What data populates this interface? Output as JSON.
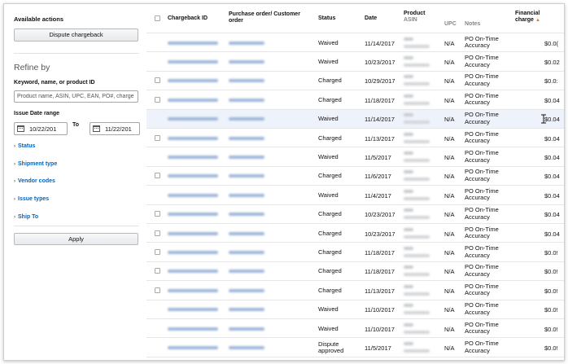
{
  "sidebar": {
    "available_actions": "Available actions",
    "dispute_button": "Dispute chargeback",
    "refine_by": "Refine by",
    "keyword_label": "Keyword, name, or product ID",
    "keyword_placeholder": "Product name, ASIN, UPC, EAN, PO#, charge",
    "issue_date_label": "Issue Date range",
    "date_from": "10/22/201",
    "to_label": "To",
    "date_to": "11/22/201",
    "filters": [
      "Status",
      "Shipment type",
      "Vendor codes",
      "Issue types",
      "Ship To"
    ],
    "apply_button": "Apply"
  },
  "table": {
    "headers": {
      "chargeback_id": "Chargeback ID",
      "purchase_order": "Purchase order/ Customer order",
      "status": "Status",
      "date": "Date",
      "product": "Product",
      "asin": "ASIN",
      "upc": "UPC",
      "notes": "Notes",
      "financial_charge": "Financial charge",
      "sort_indicator": "▲"
    },
    "rows": [
      {
        "status": "Waived",
        "date": "11/14/2017",
        "upc": "N/A",
        "notes": "PO On-Time Accuracy",
        "charge": "$0.0(",
        "checkbox": false
      },
      {
        "status": "Waived",
        "date": "10/23/2017",
        "upc": "N/A",
        "notes": "PO On-Time Accuracy",
        "charge": "$0.02",
        "checkbox": false
      },
      {
        "status": "Charged",
        "date": "10/29/2017",
        "upc": "N/A",
        "notes": "PO On-Time Accuracy",
        "charge": "$0.0:",
        "checkbox": true
      },
      {
        "status": "Charged",
        "date": "11/18/2017",
        "upc": "N/A",
        "notes": "PO On-Time Accuracy",
        "charge": "$0.04",
        "checkbox": true
      },
      {
        "status": "Waived",
        "date": "11/14/2017",
        "upc": "N/A",
        "notes": "PO On-Time Accuracy",
        "charge": "$0.04",
        "checkbox": false,
        "highlight": true
      },
      {
        "status": "Charged",
        "date": "11/13/2017",
        "upc": "N/A",
        "notes": "PO On-Time Accuracy",
        "charge": "$0.04",
        "checkbox": true
      },
      {
        "status": "Waived",
        "date": "11/5/2017",
        "upc": "N/A",
        "notes": "PO On-Time Accuracy",
        "charge": "$0.04",
        "checkbox": false
      },
      {
        "status": "Charged",
        "date": "11/6/2017",
        "upc": "N/A",
        "notes": "PO On-Time Accuracy",
        "charge": "$0.04",
        "checkbox": true
      },
      {
        "status": "Waived",
        "date": "11/4/2017",
        "upc": "N/A",
        "notes": "PO On-Time Accuracy",
        "charge": "$0.04",
        "checkbox": false
      },
      {
        "status": "Charged",
        "date": "10/23/2017",
        "upc": "N/A",
        "notes": "PO On-Time Accuracy",
        "charge": "$0.04",
        "checkbox": true
      },
      {
        "status": "Charged",
        "date": "10/23/2017",
        "upc": "N/A",
        "notes": "PO On-Time Accuracy",
        "charge": "$0.04",
        "checkbox": true
      },
      {
        "status": "Charged",
        "date": "11/18/2017",
        "upc": "N/A",
        "notes": "PO On-Time Accuracy",
        "charge": "$0.0!",
        "checkbox": true
      },
      {
        "status": "Charged",
        "date": "11/18/2017",
        "upc": "N/A",
        "notes": "PO On-Time Accuracy",
        "charge": "$0.0!",
        "checkbox": true
      },
      {
        "status": "Charged",
        "date": "11/13/2017",
        "upc": "N/A",
        "notes": "PO On-Time Accuracy",
        "charge": "$0.0!",
        "checkbox": true
      },
      {
        "status": "Waived",
        "date": "11/10/2017",
        "upc": "N/A",
        "notes": "PO On-Time Accuracy",
        "charge": "$0.0!",
        "checkbox": false
      },
      {
        "status": "Waived",
        "date": "11/10/2017",
        "upc": "N/A",
        "notes": "PO On-Time Accuracy",
        "charge": "$0.0!",
        "checkbox": false
      },
      {
        "status": "Dispute approved",
        "date": "11/5/2017",
        "upc": "N/A",
        "notes": "PO On-Time Accuracy",
        "charge": "$0.0!",
        "checkbox": false
      }
    ]
  },
  "colors": {
    "link": "#0066c0",
    "sort": "#e47911",
    "highlight_row": "#eef3fb"
  }
}
